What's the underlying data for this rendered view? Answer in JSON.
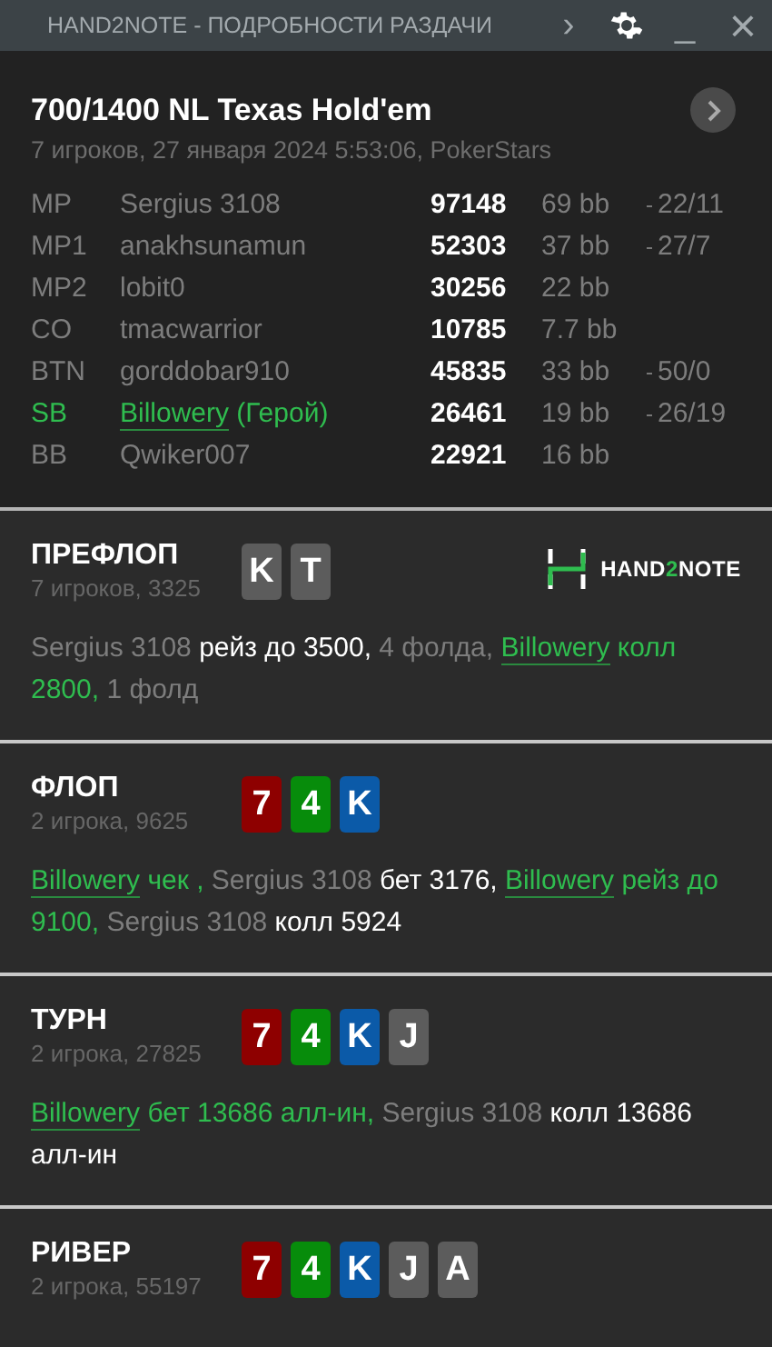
{
  "window": {
    "title": "HAND2NOTE - ПОДРОБНОСТИ РАЗДАЧИ",
    "forward": "›",
    "minimize": "_",
    "close": "×"
  },
  "hand": {
    "title": "700/1400 NL Texas Hold'em",
    "subtitle": "7 игроков, 27 января 2024 5:53:06, PokerStars"
  },
  "players": [
    {
      "position": "MP",
      "name": "Sergius 3108",
      "stack": "97148",
      "bb": "69 bb",
      "stats": "22/11",
      "hero": false
    },
    {
      "position": "MP1",
      "name": "anakhsunamun",
      "stack": "52303",
      "bb": "37 bb",
      "stats": "27/7",
      "hero": false
    },
    {
      "position": "MP2",
      "name": "lobit0",
      "stack": "30256",
      "bb": "22 bb",
      "hero": false
    },
    {
      "position": "CO",
      "name": "tmacwarrior",
      "stack": "10785",
      "bb": "7.7 bb",
      "hero": false
    },
    {
      "position": "BTN",
      "name": "gorddobar910",
      "stack": "45835",
      "bb": "33 bb",
      "stats": "50/0",
      "hero": false
    },
    {
      "position": "SB",
      "name": "Billowery",
      "name_note": "(Герой)",
      "stack": "26461",
      "bb": "19 bb",
      "stats": "26/19",
      "hero": true
    },
    {
      "position": "BB",
      "name": "Qwiker007",
      "stack": "22921",
      "bb": "16 bb",
      "hero": false
    }
  ],
  "streets": [
    {
      "name": "ПРЕФЛОП",
      "info": "7 игроков, 3325",
      "cards": [
        {
          "rank": "K",
          "color": "#5c5c5c"
        },
        {
          "rank": "T",
          "color": "#5c5c5c"
        }
      ],
      "logo": {
        "lead": "HAND",
        "accent": "2",
        "tail": "NOTE"
      },
      "actions": [
        {
          "kind": "player",
          "text": "Sergius 3108"
        },
        {
          "kind": "action",
          "text": "рейз до 3500,"
        },
        {
          "kind": "player",
          "text": "4 фолда,"
        },
        {
          "kind": "hero",
          "text": "Billowery"
        },
        {
          "kind": "hero-action",
          "text": "колл 2800,"
        },
        {
          "kind": "player",
          "text": "1 фолд"
        }
      ]
    },
    {
      "name": "ФЛОП",
      "info": "2 игрока, 9625",
      "cards": [
        {
          "rank": "7",
          "color": "#8e0000"
        },
        {
          "rank": "4",
          "color": "#078c0b"
        },
        {
          "rank": "K",
          "color": "#0b5aa8"
        }
      ],
      "actions": [
        {
          "kind": "hero",
          "text": "Billowery"
        },
        {
          "kind": "hero-action",
          "text": "чек ,"
        },
        {
          "kind": "player",
          "text": "Sergius 3108"
        },
        {
          "kind": "action",
          "text": "бет 3176,"
        },
        {
          "kind": "hero",
          "text": "Billowery"
        },
        {
          "kind": "hero-action",
          "text": "рейз до 9100,"
        },
        {
          "kind": "player",
          "text": "Sergius 3108"
        },
        {
          "kind": "action",
          "text": "колл 5924"
        }
      ]
    },
    {
      "name": "ТУРН",
      "info": "2 игрока, 27825",
      "cards": [
        {
          "rank": "7",
          "color": "#8e0000"
        },
        {
          "rank": "4",
          "color": "#078c0b"
        },
        {
          "rank": "K",
          "color": "#0b5aa8"
        },
        {
          "rank": "J",
          "color": "#5c5c5c"
        }
      ],
      "actions": [
        {
          "kind": "hero",
          "text": "Billowery"
        },
        {
          "kind": "hero-action",
          "text": "бет 13686 алл-ин,"
        },
        {
          "kind": "player",
          "text": "Sergius 3108"
        },
        {
          "kind": "action",
          "text": "колл 13686 алл-ин"
        }
      ]
    },
    {
      "name": "РИВЕР",
      "info": "2 игрока, 55197",
      "cards": [
        {
          "rank": "7",
          "color": "#8e0000"
        },
        {
          "rank": "4",
          "color": "#078c0b"
        },
        {
          "rank": "K",
          "color": "#0b5aa8"
        },
        {
          "rank": "J",
          "color": "#5c5c5c"
        },
        {
          "rank": "A",
          "color": "#5c5c5c"
        }
      ]
    }
  ]
}
